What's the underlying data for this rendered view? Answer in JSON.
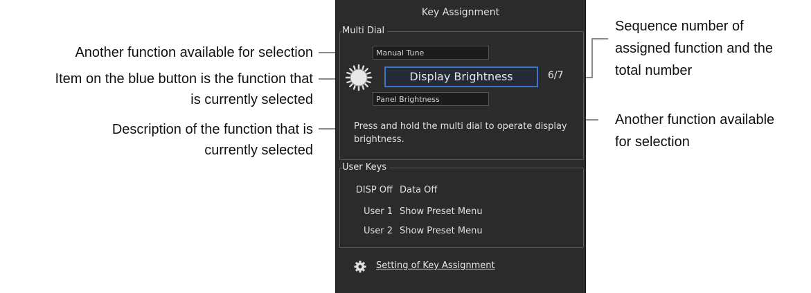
{
  "panel": {
    "title": "Key Assignment",
    "multi_dial": {
      "label": "Multi Dial",
      "prev_option": "Manual Tune",
      "selected": "Display Brightness",
      "sequence": "6/7",
      "next_option": "Panel Brightness",
      "description": "Press and hold the multi dial to operate display brightness."
    },
    "user_keys": {
      "label": "User Keys",
      "rows": [
        {
          "key": "DISP Off",
          "value": "Data Off"
        },
        {
          "key": "User 1",
          "value": "Show Preset Menu"
        },
        {
          "key": "User 2",
          "value": "Show Preset Menu"
        }
      ]
    },
    "settings_link": "Setting of Key Assignment"
  },
  "callouts": {
    "another_function_left": "Another function available for selection",
    "selected_item_line1": "Item on the blue button is the function that",
    "selected_item_line2": "is currently selected",
    "description_line1": "Description of the function that is",
    "description_line2": "currently selected",
    "sequence_line1": "Sequence number of",
    "sequence_line2": "assigned function and the",
    "sequence_line3": "total number",
    "another_function_right_line1": "Another function available",
    "another_function_right_line2": "for selection"
  },
  "colors": {
    "panel_bg": "#2b2b2b",
    "selected_border": "#3a77c8",
    "leader_line": "#8a8a8a"
  }
}
